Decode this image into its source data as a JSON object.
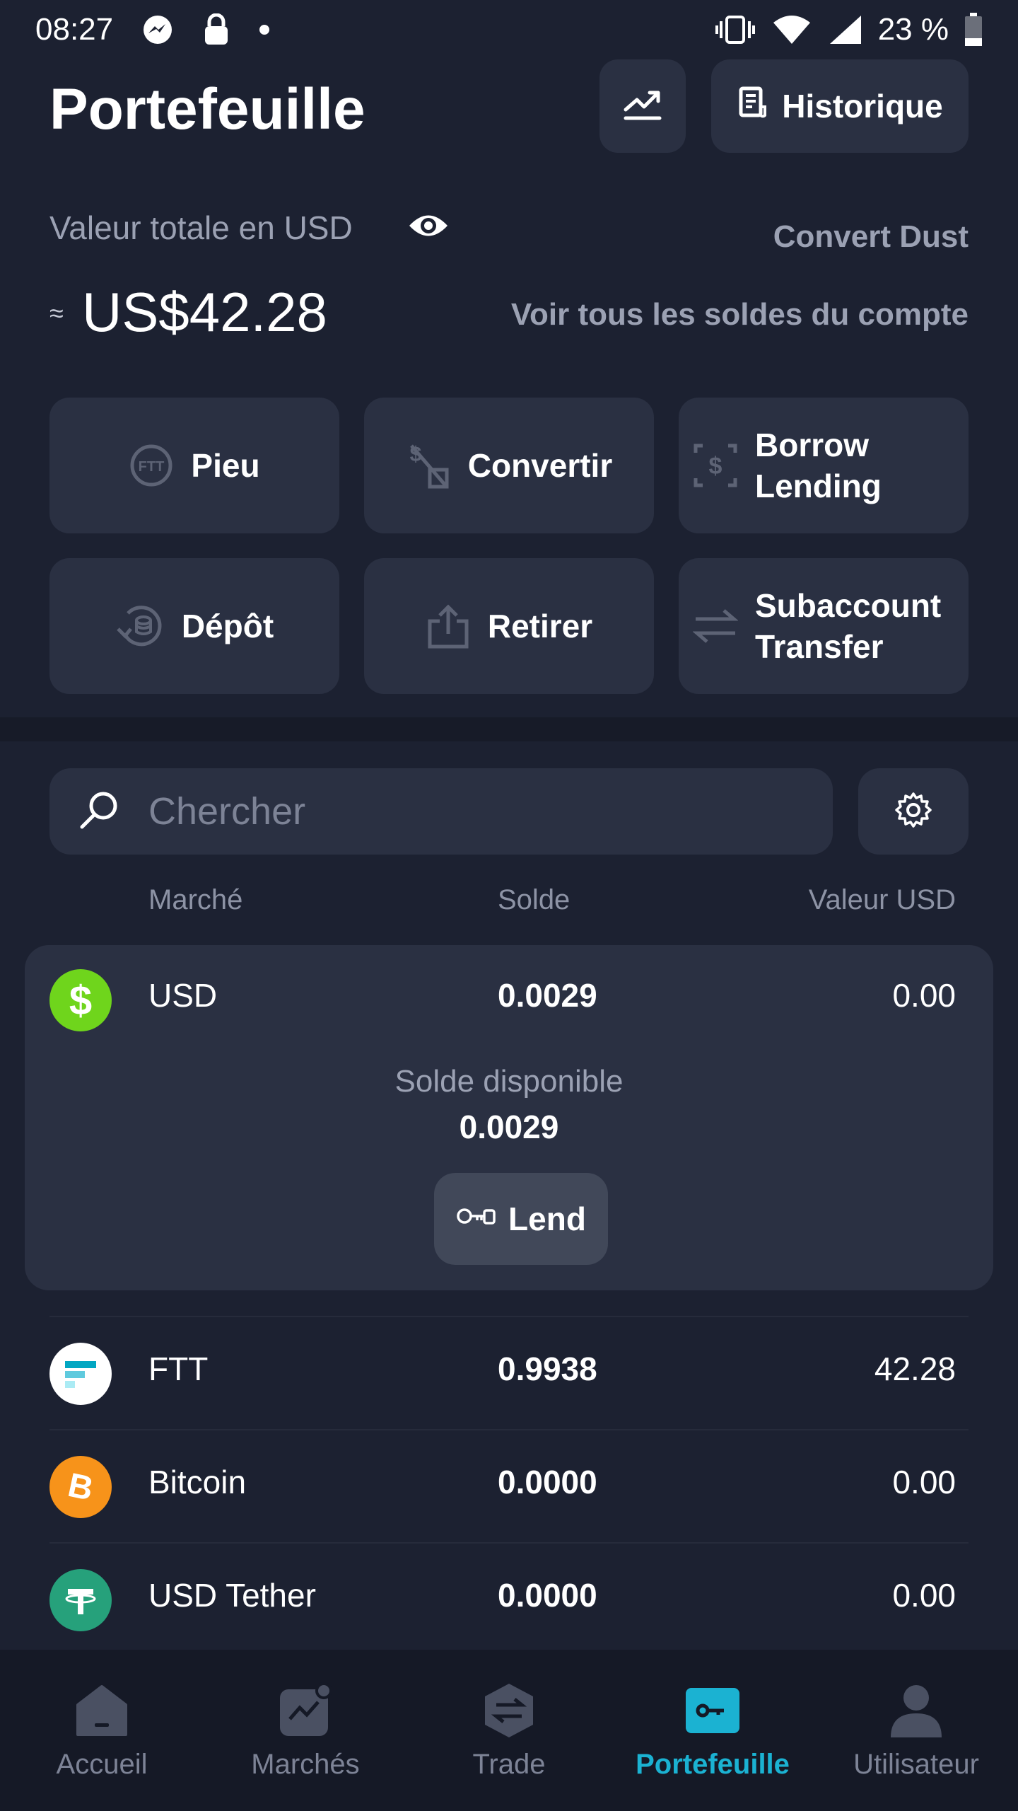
{
  "status_bar": {
    "time": "08:27",
    "battery": "23 %",
    "icons": [
      "messenger-icon",
      "vpn-lock-icon",
      "dot-icon",
      "vibrate-icon",
      "wifi-icon",
      "signal-icon",
      "battery-icon"
    ]
  },
  "header": {
    "title": "Portefeuille",
    "chart_icon": "trend-chart-icon",
    "history_label": "Historique",
    "history_icon": "receipt-icon"
  },
  "summary": {
    "total_label": "Valeur totale en USD",
    "approx_symbol": "≈",
    "total_value": "US$42.28",
    "convert_dust": "Convert Dust",
    "all_balances": "Voir tous les soldes du compte"
  },
  "actions": [
    {
      "label": "Pieu",
      "icon": "ftt-stake-icon"
    },
    {
      "label": "Convertir",
      "icon": "convert-icon"
    },
    {
      "label": "Borrow Lending",
      "line1": "Borrow",
      "line2": "Lending",
      "icon": "borrow-icon"
    },
    {
      "label": "Dépôt",
      "icon": "deposit-icon"
    },
    {
      "label": "Retirer",
      "icon": "withdraw-icon"
    },
    {
      "label": "Subaccount Transfer",
      "line1": "Subaccount",
      "line2": "Transfer",
      "icon": "transfer-icon"
    }
  ],
  "search": {
    "placeholder": "Chercher",
    "value": ""
  },
  "table": {
    "columns": [
      "Marché",
      "Solde",
      "Valeur USD"
    ],
    "rows": [
      {
        "name": "USD",
        "balance": "0.0029",
        "value": "0.00",
        "icon": "usd-coin-icon",
        "color": "#6fd51c"
      },
      {
        "name": "FTT",
        "balance": "0.9938",
        "value": "42.28",
        "icon": "ftt-coin-icon",
        "color": "#ffffff"
      },
      {
        "name": "Bitcoin",
        "balance": "0.0000",
        "value": "0.00",
        "icon": "bitcoin-icon",
        "color": "#f7931a"
      },
      {
        "name": "USD Tether",
        "balance": "0.0000",
        "value": "0.00",
        "icon": "tether-icon",
        "color": "#26a17b"
      }
    ],
    "expanded": {
      "available_label": "Solde disponible",
      "available_value": "0.0029",
      "lend_label": "Lend"
    }
  },
  "bottom_nav": [
    {
      "label": "Accueil",
      "icon": "home-icon",
      "active": false
    },
    {
      "label": "Marchés",
      "icon": "markets-icon",
      "active": false
    },
    {
      "label": "Trade",
      "icon": "trade-icon",
      "active": false
    },
    {
      "label": "Portefeuille",
      "icon": "wallet-icon",
      "active": true
    },
    {
      "label": "Utilisateur",
      "icon": "user-icon",
      "active": false
    }
  ],
  "colors": {
    "background": "#1c2131",
    "card": "#2a3042",
    "accent": "#1bb2d2",
    "muted_text": "#9ba1b3"
  }
}
